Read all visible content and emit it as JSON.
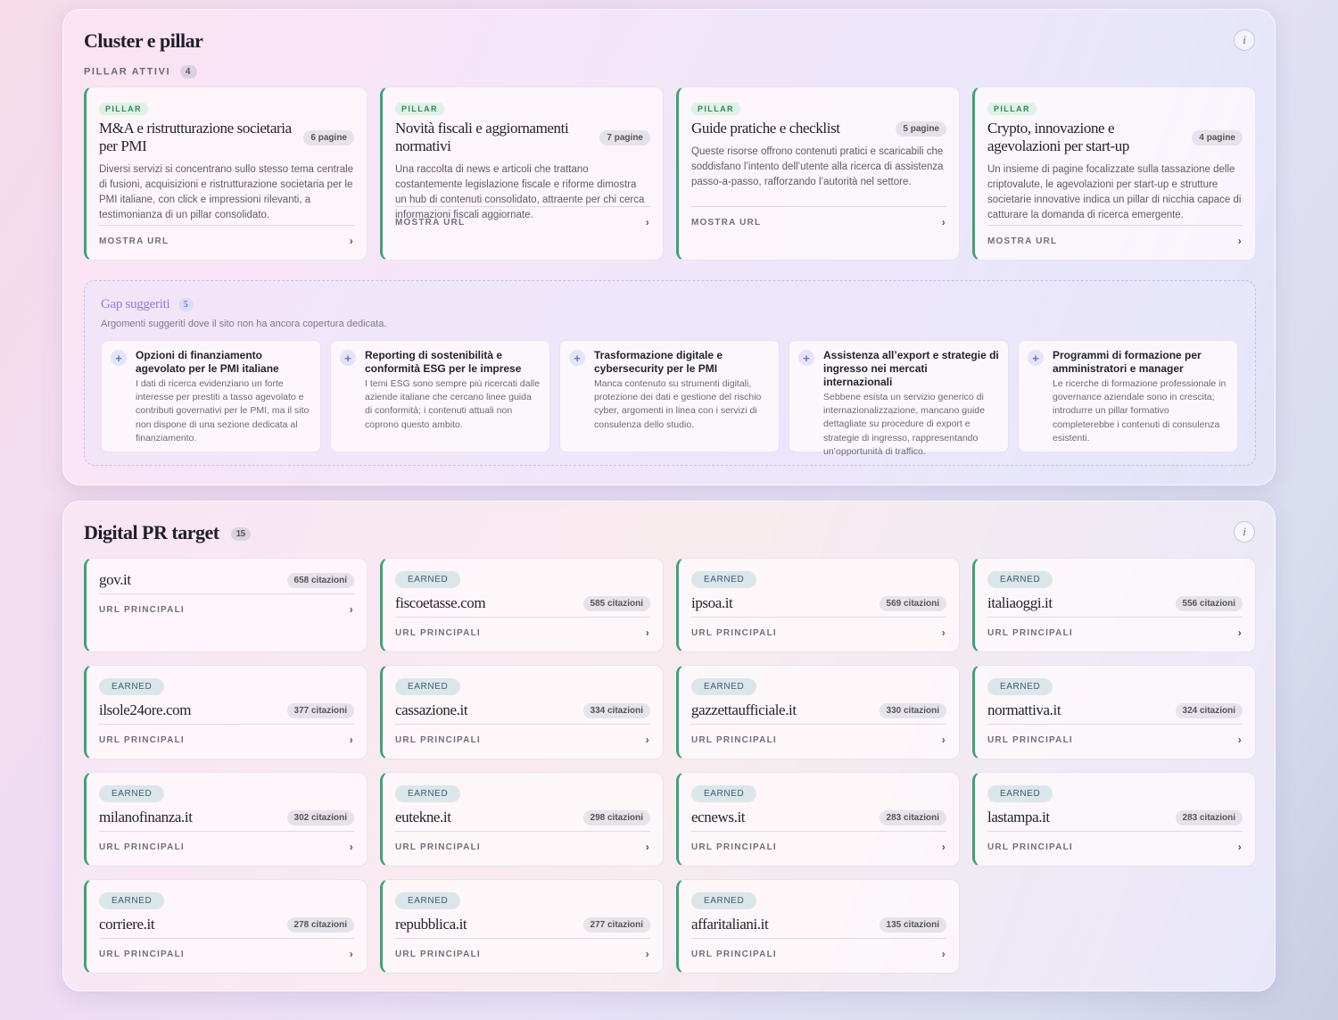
{
  "cluster": {
    "title": "Cluster e pillar",
    "info_icon": "i",
    "pillars_label": "PILLAR ATTIVI",
    "pillars_count": "4",
    "pillars": [
      {
        "tag": "PILLAR",
        "title": "M&A e ristrutturazione societaria per PMI",
        "pages": "6 pagine",
        "desc": "Diversi servizi si concentrano sullo stesso tema centrale di fusioni, acquisizioni e ristrutturazione societaria per le PMI italiane, con click e impressioni rilevanti, a testimonianza di un pillar consolidato.",
        "footer": "MOSTRA URL"
      },
      {
        "tag": "PILLAR",
        "title": "Novità fiscali e aggiornamenti normativi",
        "pages": "7 pagine",
        "desc": "Una raccolta di news e articoli che trattano costantemente legislazione fiscale e riforme dimostra un hub di contenuti consolidato, attraente per chi cerca informazioni fiscali aggiornate.",
        "footer": "MOSTRA URL"
      },
      {
        "tag": "PILLAR",
        "title": "Guide pratiche e checklist",
        "pages": "5 pagine",
        "desc": "Queste risorse offrono contenuti pratici e scaricabili che soddisfano l’intento dell’utente alla ricerca di assistenza passo-a-passo, rafforzando l’autorità nel settore.",
        "footer": "MOSTRA URL"
      },
      {
        "tag": "PILLAR",
        "title": "Crypto, innovazione e agevolazioni per start-up",
        "pages": "4 pagine",
        "desc": "Un insieme di pagine focalizzate sulla tassazione delle criptovalute, le agevolazioni per start-up e strutture societarie innovative indica un pillar di nicchia capace di catturare la domanda di ricerca emergente.",
        "footer": "MOSTRA URL"
      }
    ],
    "gaps": {
      "title": "Gap suggeriti",
      "count": "5",
      "subtitle": "Argomenti suggeriti dove il sito non ha ancora copertura dedicata.",
      "items": [
        {
          "title": "Opzioni di finanziamento agevolato per le PMI italiane",
          "desc": "I dati di ricerca evidenziano un forte interesse per prestiti a tasso agevolato e contributi governativi per le PMI, ma il sito non dispone di una sezione dedicata al finanziamento."
        },
        {
          "title": "Reporting di sostenibilità e conformità ESG per le imprese",
          "desc": "I temi ESG sono sempre più ricercati dalle aziende italiane che cercano linee guida di conformità; i contenuti attuali non coprono questo ambito."
        },
        {
          "title": "Trasformazione digitale e cybersecurity per le PMI",
          "desc": "Manca contenuto su strumenti digitali, protezione dei dati e gestione del rischio cyber, argomenti in linea con i servizi di consulenza dello studio."
        },
        {
          "title": "Assistenza all’export e strategie di ingresso nei mercati internazionali",
          "desc": "Sebbene esista un servizio generico di internazionalizzazione, mancano guide dettagliate su procedure di export e strategie di ingresso, rappresentando un’opportunità di traffico."
        },
        {
          "title": "Programmi di formazione per amministratori e manager",
          "desc": "Le ricerche di formazione professionale in governance aziendale sono in crescita; introdurre un pillar formativo completerebbe i contenuti di consulenza esistenti."
        }
      ]
    }
  },
  "pr": {
    "title": "Digital PR target",
    "count": "15",
    "info_icon": "i",
    "footer_label": "URL PRINCIPALI",
    "targets": [
      {
        "tag": "",
        "domain": "gov.it",
        "citations": "658 citazioni"
      },
      {
        "tag": "EARNED",
        "domain": "fiscoetasse.com",
        "citations": "585 citazioni"
      },
      {
        "tag": "EARNED",
        "domain": "ipsoa.it",
        "citations": "569 citazioni"
      },
      {
        "tag": "EARNED",
        "domain": "italiaoggi.it",
        "citations": "556 citazioni"
      },
      {
        "tag": "EARNED",
        "domain": "ilsole24ore.com",
        "citations": "377 citazioni"
      },
      {
        "tag": "EARNED",
        "domain": "cassazione.it",
        "citations": "334 citazioni"
      },
      {
        "tag": "EARNED",
        "domain": "gazzettaufficiale.it",
        "citations": "330 citazioni"
      },
      {
        "tag": "EARNED",
        "domain": "normattiva.it",
        "citations": "324 citazioni"
      },
      {
        "tag": "EARNED",
        "domain": "milanofinanza.it",
        "citations": "302 citazioni"
      },
      {
        "tag": "EARNED",
        "domain": "eutekne.it",
        "citations": "298 citazioni"
      },
      {
        "tag": "EARNED",
        "domain": "ecnews.it",
        "citations": "283 citazioni"
      },
      {
        "tag": "EARNED",
        "domain": "lastampa.it",
        "citations": "283 citazioni"
      },
      {
        "tag": "EARNED",
        "domain": "corriere.it",
        "citations": "278 citazioni"
      },
      {
        "tag": "EARNED",
        "domain": "repubblica.it",
        "citations": "277 citazioni"
      },
      {
        "tag": "EARNED",
        "domain": "affaritaliani.it",
        "citations": "135 citazioni"
      }
    ]
  },
  "colors": {
    "accent_green": "#3fa274",
    "gap_accent": "#8a7ed8",
    "earned_tag": "#3b5d74"
  }
}
